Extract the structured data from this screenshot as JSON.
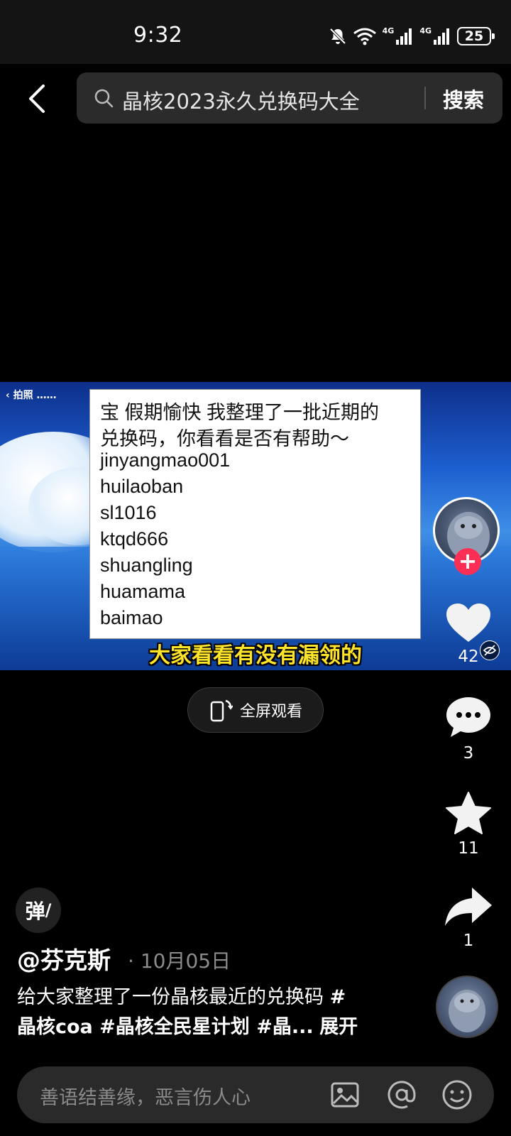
{
  "status_bar": {
    "time": "9:32",
    "network_1": "4G",
    "network_2": "4G",
    "battery": "25"
  },
  "search": {
    "query": "晶核2023永久兑换码大全",
    "button_label": "搜索"
  },
  "video": {
    "back_label": "拍照",
    "note_lines": [
      "宝 假期愉快 我整理了一批近期的",
      "兑换码，你看看是否有帮助～",
      "jinyangmao001",
      "huilaoban",
      "sl1016",
      "ktqd666",
      "shuangling",
      "huamama",
      "baimao"
    ],
    "subtitle": "大家看看有没有漏领的"
  },
  "actions": {
    "like_count": "42",
    "comment_count": "3",
    "favorite_count": "11",
    "share_count": "1"
  },
  "fullscreen": {
    "label": "全屏观看"
  },
  "post": {
    "danmaku_label": "弹",
    "author": "@芬克斯",
    "date": "10月05日",
    "description": "给大家整理了一份晶核最近的兑换码 ",
    "tag_1": "#",
    "tags_line": "晶核coa #晶核全民星计划 #晶...",
    "expand_label": "展开"
  },
  "comment_bar": {
    "placeholder": "善语结善缘，恶言伤人心"
  },
  "colors": {
    "accent": "#ff2e55",
    "subtitle": "#ffe42a",
    "background": "#000000"
  }
}
